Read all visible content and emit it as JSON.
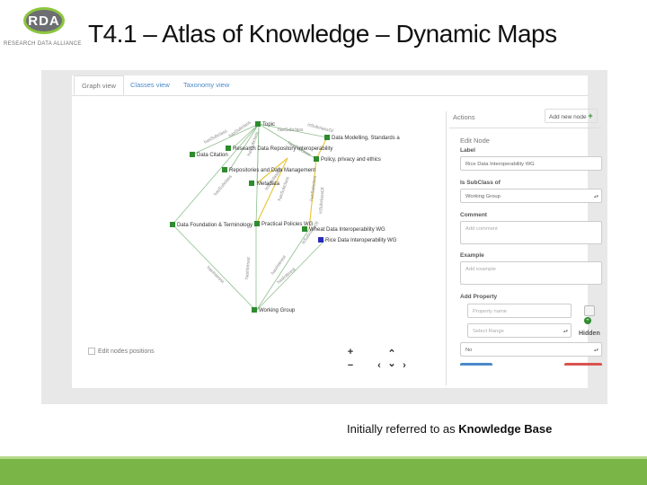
{
  "logo": {
    "name": "RDA",
    "subtitle": "RESEARCH DATA ALLIANCE"
  },
  "title": "T4.1 – Atlas of Knowledge – Dynamic Maps",
  "tabs": [
    "Graph view",
    "Classes view",
    "Taxonomy view"
  ],
  "graph": {
    "nodes": [
      "Topic",
      "Data Modelling, Standards a",
      "Research Data Repository Interoperability",
      "Data Citation",
      "Policy, privacy and ethics",
      "Repositories and Data Management",
      "Metadata",
      "Data Foundation & Terminology",
      "Practical Policies WG",
      "Wheat Data Interoperability WG",
      "Rice Data Interoperability WG",
      "Working Group"
    ],
    "edge_labels": [
      "hasSubclass",
      "hasSubclass",
      "hasSubclass",
      "hasSubclass",
      "hasSubclass",
      "hasSubclass",
      "hasSubclass",
      "hasSubclass",
      "hasInterest",
      "hasInterest",
      "hasInterest",
      "hasInterest",
      "isSubclassOf",
      "isSubclassOf",
      "isSubclassOf",
      "isSubclassOf"
    ],
    "edit_positions_label": "Edit nodes positions",
    "nav_icons": [
      "+",
      "−",
      "‹",
      "›",
      "⌃",
      "⌄"
    ]
  },
  "panel": {
    "actions_label": "Actions",
    "add_node_label": "Add new node",
    "edit_node_label": "Edit Node",
    "label_label": "Label",
    "label_value": "Rice Data Interoperability WG",
    "subclass_label": "Is SubClass of",
    "subclass_value": "Working Group",
    "comment_label": "Comment",
    "comment_placeholder": "Add comment",
    "example_label": "Example",
    "example_placeholder": "Add example",
    "add_property_label": "Add Property",
    "property_placeholder": "Property name",
    "range_placeholder": "Select Range",
    "hidden_label": "Hidden",
    "hidden_value": "No"
  },
  "footnote": {
    "prefix": "Initially referred to as ",
    "bold": "Knowledge Base"
  },
  "colors": {
    "accent_green": "#7ab547",
    "node_green": "#2e8b2e",
    "node_blue": "#2a2ab8",
    "link_blue": "#4a8ac9"
  }
}
